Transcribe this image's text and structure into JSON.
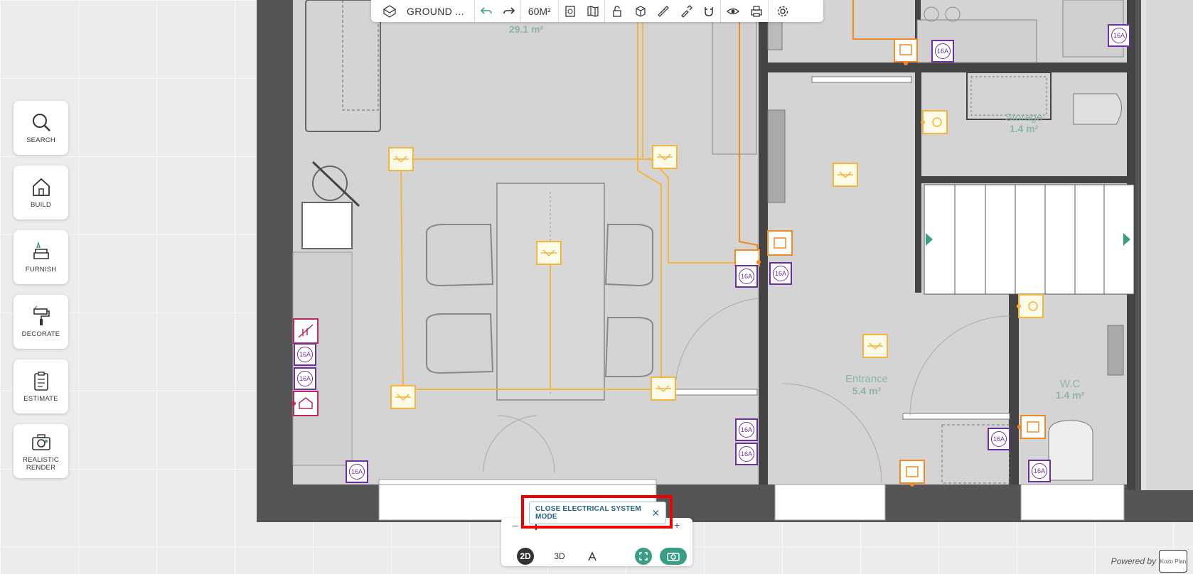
{
  "left_tools": [
    {
      "label": "SEARCH",
      "icon": "search-icon"
    },
    {
      "label": "BUILD",
      "icon": "house-icon"
    },
    {
      "label": "FURNISH",
      "icon": "sofa-icon"
    },
    {
      "label": "DECORATE",
      "icon": "paint-roller-icon"
    },
    {
      "label": "ESTIMATE",
      "icon": "clipboard-icon"
    },
    {
      "label": "REALISTIC RENDER",
      "icon": "camera-icon"
    }
  ],
  "toolbar": {
    "level_label": "GROUND ...",
    "area_label": "60M²"
  },
  "rooms": {
    "top_area": "29.1 m²",
    "storage_name": "Storage",
    "storage_area": "1.4 m²",
    "entrance_name": "Entrance",
    "entrance_area": "5.4 m²",
    "wc_name": "W.C",
    "wc_area": "1.4 m²"
  },
  "outlet_label": "16A",
  "bottom": {
    "close_label": "CLOSE ELECTRICAL SYSTEM MODE",
    "zoom_minus": "–",
    "zoom_plus": "+",
    "mode_2d": "2D",
    "mode_3d": "3D"
  },
  "footer": {
    "powered_by": "Powered by",
    "logo_text": "Kozo Plan"
  },
  "colors": {
    "light": "#f5b43c",
    "outlet": "#6b2fa0",
    "switch": "#f08a24",
    "network": "#b72a5b",
    "accent": "#3a9e86"
  }
}
